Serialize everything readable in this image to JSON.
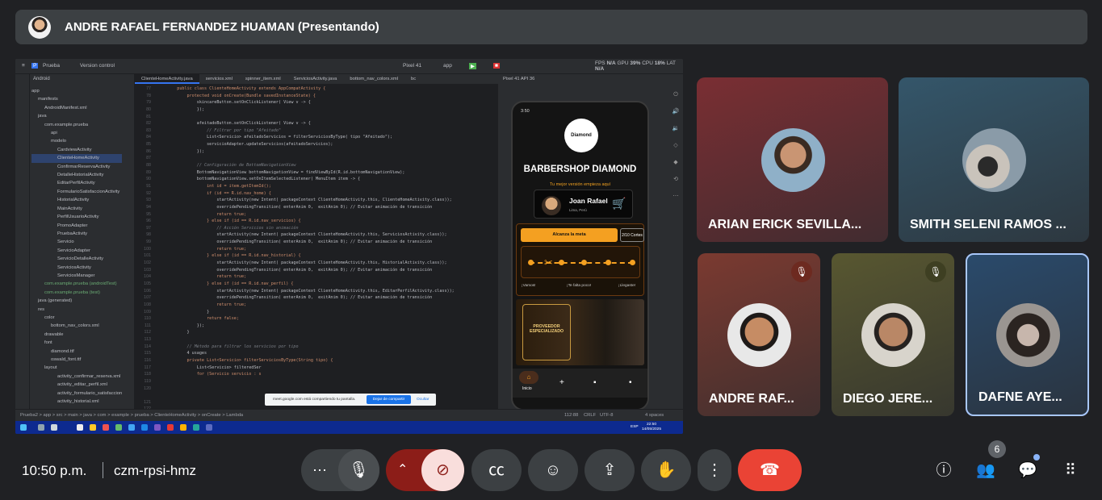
{
  "presenter_banner": {
    "name": "ANDRE RAFAEL FERNANDEZ HUAMAN (Presentando)"
  },
  "shared_screen": {
    "ide_toolbar": {
      "project": "Prueba",
      "vcs": "Version control",
      "device": "Pixel 41",
      "app": "app"
    },
    "monitor": {
      "fps_label": "FPS",
      "fps": "N/A",
      "gpu_label": "GPU",
      "gpu": "39%",
      "cpu_label": "CPU",
      "cpu": "18%",
      "lat_label": "LAT",
      "lat": "N/A"
    },
    "project_panel": {
      "header": "Android",
      "tree": [
        "app",
        "manifests",
        "AndroidManifest.xml",
        "java",
        "com.example.prueba",
        "api",
        "modelo",
        "CardviewActivity",
        "ClienteHomeActivity",
        "ConfirmarReservaActivity",
        "DetalleHistorialActivity",
        "EditarPerfilActivity",
        "FormularioSatisfaccionActivity",
        "HistorialActivity",
        "MainActivity",
        "PerfilUsuarioActivity",
        "PromoAdapter",
        "PruebaActivity",
        "Servicio",
        "ServicioAdapter",
        "ServicioDetalleActivity",
        "ServiciosActivity",
        "ServiciosManager",
        "com.example.prueba (androidTest)",
        "com.example.prueba (test)",
        "java (generated)",
        "res",
        "color",
        "bottom_nav_colors.xml",
        "drawable",
        "font",
        "diamond.ttf",
        "oswald_font.ttf",
        "layout",
        "activity_confirmar_reserva.xml",
        "activity_editar_perfil.xml",
        "activity_formulario_satisfaccion",
        "activity_historial.xml"
      ]
    },
    "editor": {
      "tabs": [
        "ClienteHomeActivity.java",
        "servicios.xml",
        "spinner_item.xml",
        "ServiciosActivity.java",
        "bottom_nav_colors.xml",
        "bc"
      ],
      "line_numbers": [
        "77",
        "78",
        "79",
        "80",
        "81",
        "82",
        "83",
        "84",
        "85",
        "86",
        "87",
        "88",
        "89",
        "90",
        "91",
        "92",
        "93",
        "94",
        "95",
        "96",
        "97",
        "98",
        "99",
        "100",
        "101",
        "102",
        "103",
        "104",
        "105",
        "106",
        "107",
        "108",
        "109",
        "110",
        "111",
        "112",
        "113",
        "114",
        "115",
        "116",
        "117",
        "118",
        "119",
        "120",
        "",
        "121",
        "122",
        "123"
      ],
      "lines": [
        "    public class ClienteHomeActivity extends AppCompatActivity {",
        "        protected void onCreate(Bundle savedInstanceState) {",
        "            skincareButton.setOnClickListener( View v -> {",
        "            });",
        "",
        "            afeitadoButton.setOnClickListener( View v -> {",
        "                // Filtrar por tipo \"Afeitado\"",
        "                List<Servicio> afeitadoServicios = filterServiciosByType( tipo \"Afeitado\");",
        "                servicioAdapter.updateServicios(afeitadoServicios);",
        "            });",
        "",
        "            // Configuración de BottomNavigationView",
        "            BottomNavigationView bottomNavigationView = findViewById(R.id.bottomNavigationView);",
        "            bottomNavigationView.setOnItemSelectedListener( MenuItem item -> {",
        "                int id = item.getItemId();",
        "                if (id == R.id.nav_home) {",
        "                    startActivity(new Intent( packageContext ClienteHomeActivity.this, ClienteHomeActivity.class));",
        "                    overridePendingTransition( enterAnim 0,  exitAnim 0); // Evitar animación de transición",
        "                    return true;",
        "                } else if (id == R.id.nav_servicios) {",
        "                    // Acción Servicios sin animación",
        "                    startActivity(new Intent( packageContext ClienteHomeActivity.this, ServiciosActivity.class));",
        "                    overridePendingTransition( enterAnim 0,  exitAnim 0); // Evitar animación de transición",
        "                    return true;",
        "                } else if (id == R.id.nav_historial) {",
        "                    startActivity(new Intent( packageContext ClienteHomeActivity.this, HistorialActivity.class));",
        "                    overridePendingTransition( enterAnim 0,  exitAnim 0); // Evitar animación de transición",
        "                    return true;",
        "                } else if (id == R.id.nav_perfil) {",
        "                    startActivity(new Intent( packageContext ClienteHomeActivity.this, EditarPerfilActivity.class));",
        "                    overridePendingTransition( enterAnim 0,  exitAnim 0); // Evitar animación de transición",
        "                    return true;",
        "                }",
        "                return false;",
        "            });",
        "        }",
        "",
        "        // Método para filtrar los servicios por tipo",
        "        4 usages",
        "        private List<Servicio> filterServiciosByType(String tipo) {",
        "            List<Servicio> filteredSer",
        "            for (Servicio servicio : s"
      ]
    },
    "emulator": {
      "title": "Pixel 41 API 36",
      "status_time": "3:50",
      "logo": "Diamond",
      "shop_name": "BARBERSHOP DIAMOND",
      "motto": "Tu mejor versión empieza aquí",
      "user_name": "Joan Rafael",
      "user_location": "Lima, Perú",
      "goal_button": "Alcanza la meta",
      "goal_count": "2/10 Cortes",
      "progress_labels": [
        "¡Vamos!",
        "¡Te falta poco!",
        "¡Llegaste!"
      ],
      "promo_text": "PROVEEDOR ESPECIALIZADO",
      "nav_home": "Inicio"
    },
    "share_notice": {
      "text": "meet.google.com está compartiendo tu pantalla.",
      "stop_button": "Dejar de compartir",
      "hide_button": "Ocultar"
    },
    "ide_status": {
      "breadcrumb": "Prueba2 > app > src > main > java > com > example > prueba > ClienteHomeActivity > onCreate > Lambda",
      "position": "112:88",
      "line_sep": "CRLF",
      "encoding": "UTF-8",
      "indent": "4 spaces"
    },
    "taskbar": {
      "time": "22:50",
      "date": "14/05/2025",
      "lang": "ESP"
    }
  },
  "participants": [
    {
      "name": "ARIAN ERICK SEVILLA...",
      "bg": "#7a2e33",
      "muted": false
    },
    {
      "name": "SMITH SELENI RAMOS ...",
      "bg": "#34566a",
      "muted": false
    },
    {
      "name": "ANDRE RAF...",
      "bg": "#7b3a30",
      "muted": true
    },
    {
      "name": "DIEGO JERE...",
      "bg": "#585730",
      "muted": true
    },
    {
      "name": "DAFNE AYE...",
      "bg": "#2a4a6b",
      "muted": false
    }
  ],
  "meeting": {
    "time": "10:50 p.m.",
    "code": "czm-rpsi-hmz",
    "participant_count": "6",
    "colors": {
      "end_call": "#ea4335",
      "camera_off": "#f9dedc",
      "share_area": "#8c1d18",
      "active_border": "#a8c7fa"
    }
  }
}
